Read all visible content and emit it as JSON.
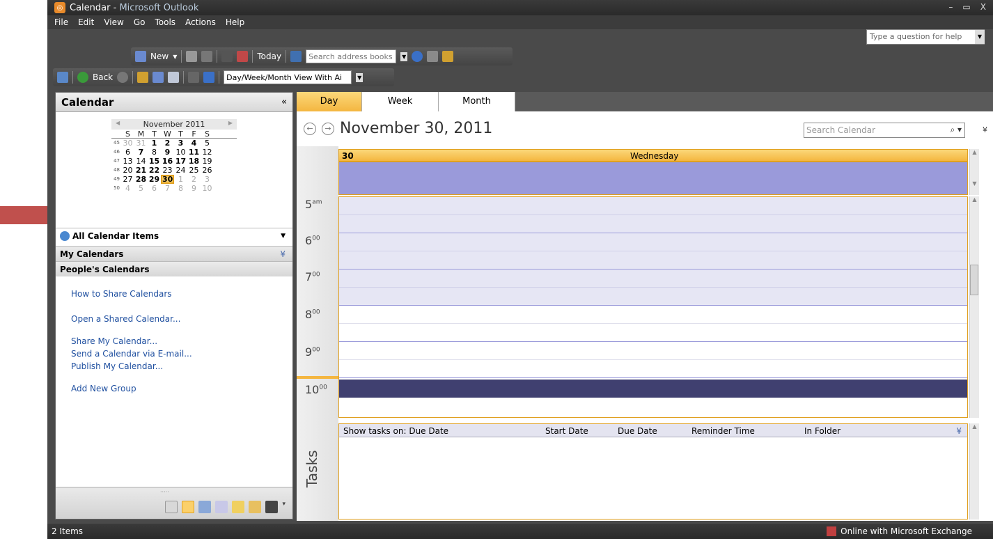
{
  "window": {
    "title_prefix": "Calendar",
    "title_sep": " - ",
    "title_app": "Microsoft Outlook",
    "controls": [
      "–",
      "▭",
      "X"
    ]
  },
  "menu": [
    "File",
    "Edit",
    "View",
    "Go",
    "Tools",
    "Actions",
    "Help"
  ],
  "help_box": {
    "placeholder": "Type a question for help"
  },
  "toolbar1": {
    "new_label": "New",
    "today_label": "Today",
    "search_placeholder": "Search address books"
  },
  "toolbar2": {
    "back_label": "Back",
    "view_select": "Day/Week/Month View With Ai"
  },
  "nav": {
    "title": "Calendar",
    "collapse_glyph": "«",
    "mini_calendar": {
      "month": "November 2011",
      "prev": "◀",
      "next": "▶",
      "dow": [
        "S",
        "M",
        "T",
        "W",
        "T",
        "F",
        "S"
      ],
      "weeks": [
        {
          "wk": "45",
          "days": [
            [
              "30",
              "dim"
            ],
            [
              "31",
              "dim"
            ],
            [
              "1",
              "bold"
            ],
            [
              "2",
              "bold"
            ],
            [
              "3",
              "bold"
            ],
            [
              "4",
              "bold"
            ],
            [
              "5",
              ""
            ]
          ]
        },
        {
          "wk": "46",
          "days": [
            [
              "6",
              ""
            ],
            [
              "7",
              "bold"
            ],
            [
              "8",
              ""
            ],
            [
              "9",
              "bold"
            ],
            [
              "10",
              ""
            ],
            [
              "11",
              "bold"
            ],
            [
              "12",
              ""
            ]
          ]
        },
        {
          "wk": "47",
          "days": [
            [
              "13",
              ""
            ],
            [
              "14",
              ""
            ],
            [
              "15",
              "bold"
            ],
            [
              "16",
              "bold"
            ],
            [
              "17",
              "bold"
            ],
            [
              "18",
              "bold"
            ],
            [
              "19",
              ""
            ]
          ]
        },
        {
          "wk": "48",
          "days": [
            [
              "20",
              ""
            ],
            [
              "21",
              "bold"
            ],
            [
              "22",
              "bold"
            ],
            [
              "23",
              ""
            ],
            [
              "24",
              ""
            ],
            [
              "25",
              ""
            ],
            [
              "26",
              ""
            ]
          ]
        },
        {
          "wk": "49",
          "days": [
            [
              "27",
              ""
            ],
            [
              "28",
              "bold"
            ],
            [
              "29",
              "bold"
            ],
            [
              "30",
              "today"
            ],
            [
              "1",
              "dim"
            ],
            [
              "2",
              "dim"
            ],
            [
              "3",
              "dim"
            ]
          ]
        },
        {
          "wk": "50",
          "days": [
            [
              "4",
              "dim"
            ],
            [
              "5",
              "dim"
            ],
            [
              "6",
              "dim"
            ],
            [
              "7",
              "dim"
            ],
            [
              "8",
              "dim"
            ],
            [
              "9",
              "dim"
            ],
            [
              "10",
              "dim"
            ]
          ]
        }
      ]
    },
    "all_items": "All Calendar Items",
    "my_calendars": "My Calendars",
    "peoples_calendars": "People's Calendars",
    "links": [
      "How to Share Calendars",
      "Open a Shared Calendar...",
      "Share My Calendar...",
      "Send a Calendar via E-mail...",
      "Publish My Calendar...",
      "Add New Group"
    ]
  },
  "view_tabs": [
    "Day",
    "Week",
    "Month"
  ],
  "main": {
    "date": "November 30, 2011",
    "search_placeholder": "Search Calendar",
    "day_num": "30",
    "day_name": "Wednesday",
    "hours": [
      {
        "h": "5",
        "s": "am"
      },
      {
        "h": "6",
        "s": "00"
      },
      {
        "h": "7",
        "s": "00"
      },
      {
        "h": "8",
        "s": "00"
      },
      {
        "h": "9",
        "s": "00"
      },
      {
        "h": "10",
        "s": "00"
      }
    ],
    "tasks_label": "Tasks",
    "task_cols": [
      "Show tasks on: Due Date",
      "Start Date",
      "Due Date",
      "Reminder Time",
      "In Folder"
    ]
  },
  "status": {
    "left": "2 Items",
    "right": "Online with Microsoft Exchange"
  },
  "colors": {
    "accent": "#f4b640",
    "allday": "#9a9ada",
    "work_hours": "#e6e6f4",
    "event_bar": "#404070",
    "arrow": "#c0504d"
  }
}
